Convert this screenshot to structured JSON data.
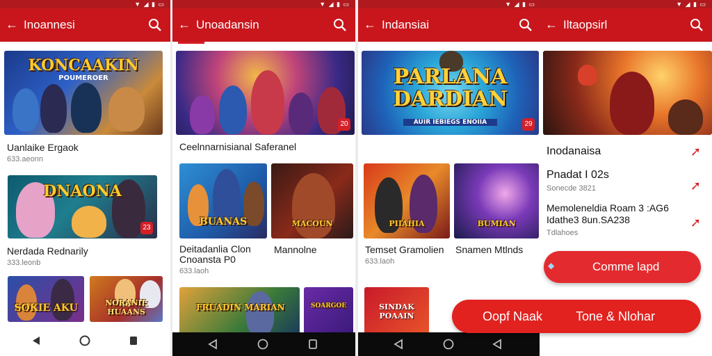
{
  "panel1": {
    "title": "Inoannesi",
    "items": [
      {
        "art": "KONCAAKIN",
        "art_sub": "POUMEROER",
        "title": "Uanlaike Ergaok",
        "sub": "633.aeonn"
      },
      {
        "art": "DNAONA",
        "art_sub": "",
        "title": "Nerdada Rednarily",
        "sub": "333.leonb",
        "badge": "23"
      },
      {
        "art": "SOKIE AKU",
        "art_sub": "",
        "title": "",
        "sub": ""
      },
      {
        "art": "NORANIE HUAANS",
        "art_sub": "",
        "title": "",
        "sub": ""
      }
    ]
  },
  "panel2": {
    "title": "Unoadansin",
    "hero_badge": "20",
    "section_title": "Ceelnnarnisianal Saferanel",
    "tiles": [
      {
        "art": "BUANAS",
        "title": "Deitadanlia Clon\nCnoansta P0",
        "sub": "633.laoh"
      },
      {
        "art": "MACOUN",
        "title": "Mannolne",
        "sub": ""
      },
      {
        "art": "FRUADIN MARIAN",
        "title": "",
        "sub": ""
      },
      {
        "art": "SOARGOE",
        "title": "",
        "sub": ""
      }
    ]
  },
  "panel3": {
    "title": "Indansiai",
    "hero_art": "PARLANA DARDIAN",
    "hero_sub": "AUIR IEBIEGS ENOIIA",
    "hero_badge": "29",
    "tiles": [
      {
        "art": "PIIAHIA",
        "title": "Temset Gramolien",
        "sub": "633.laoh"
      },
      {
        "art": "BUMIAN",
        "title": "Snamen Mtlnds",
        "sub": ""
      },
      {
        "art": "SINDAK POAAIN",
        "title": "",
        "sub": ""
      }
    ]
  },
  "panel4": {
    "title": "Iltaopsirl",
    "rows": [
      {
        "title": "Inodanaisa",
        "sub": ""
      },
      {
        "title": "Pnadat I 02s",
        "sub": "Sonecde 3821"
      },
      {
        "title": "Memoleneldia Roam 3 :AG6\nIdathe3 8un.SA238",
        "sub": "Tdlahoes"
      }
    ],
    "button_small": "Comme lapd",
    "button_large_left": "Oopf Naak",
    "button_large_right": "Tone & Nlohar"
  },
  "colors": {
    "accent": "#c8161c",
    "status": "#b01a1f"
  },
  "icons": [
    "back-arrow-icon",
    "search-icon",
    "nav-back-icon",
    "nav-home-icon",
    "nav-recents-icon",
    "share-arrow-icon"
  ]
}
